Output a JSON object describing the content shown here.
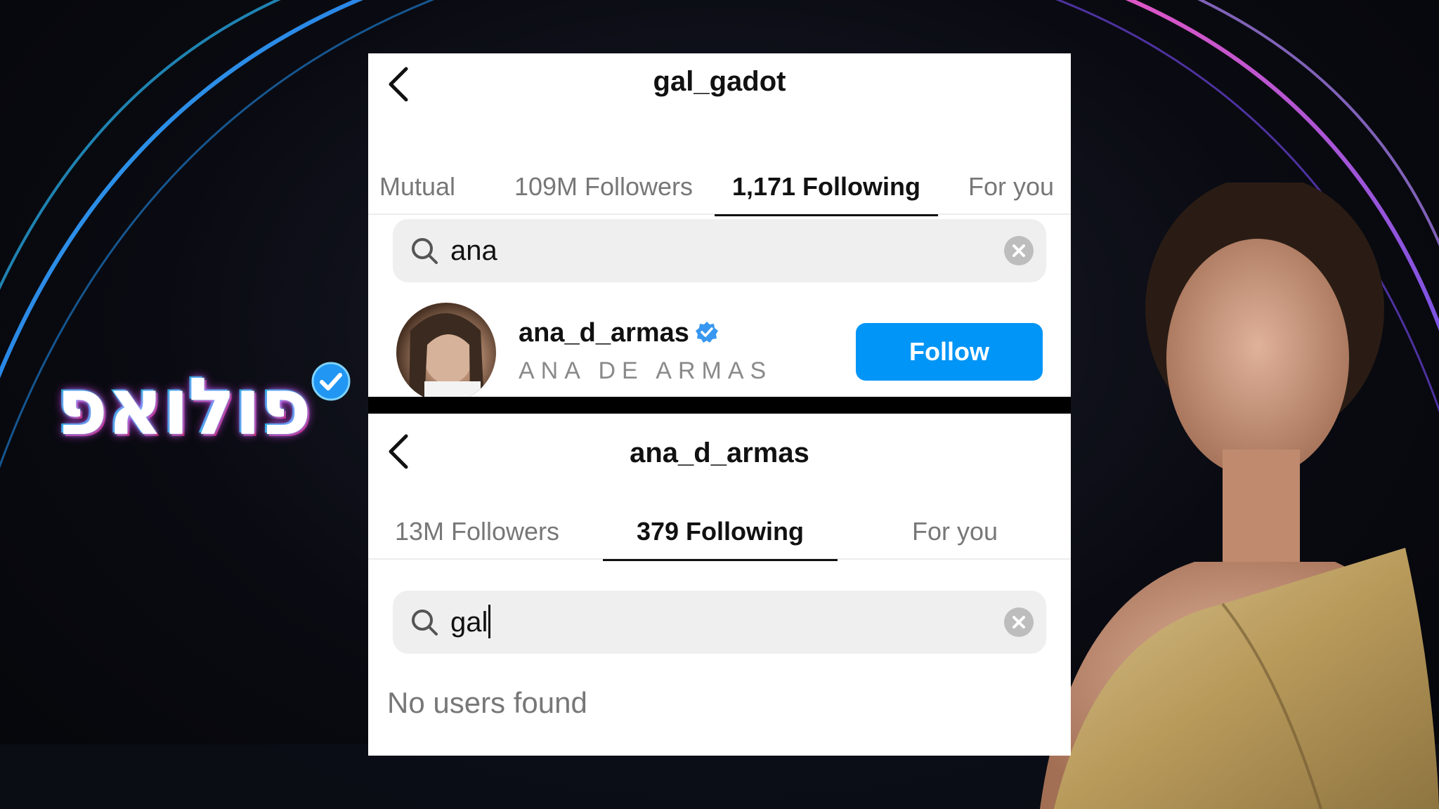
{
  "logo": {
    "text": "פולואפ"
  },
  "top_panel": {
    "title": "gal_gadot",
    "tabs": [
      {
        "label": "Mutual"
      },
      {
        "label": "109M Followers"
      },
      {
        "label": "1,171 Following"
      },
      {
        "label": "For you"
      }
    ],
    "active_tab": "1,171 Following",
    "search": {
      "value": "ana"
    },
    "result": {
      "username": "ana_d_armas",
      "full_name": "ANA DE ARMAS",
      "verified": true,
      "follow_label": "Follow"
    }
  },
  "bottom_panel": {
    "title": "ana_d_armas",
    "tabs": [
      {
        "label": "13M Followers"
      },
      {
        "label": "379 Following"
      },
      {
        "label": "For you"
      }
    ],
    "active_tab": "379 Following",
    "search": {
      "value": "gal"
    },
    "empty_message": "No users found"
  },
  "colors": {
    "follow_button": "#0095f6",
    "verified": "#3897f0",
    "backdrop": "#06070d"
  }
}
